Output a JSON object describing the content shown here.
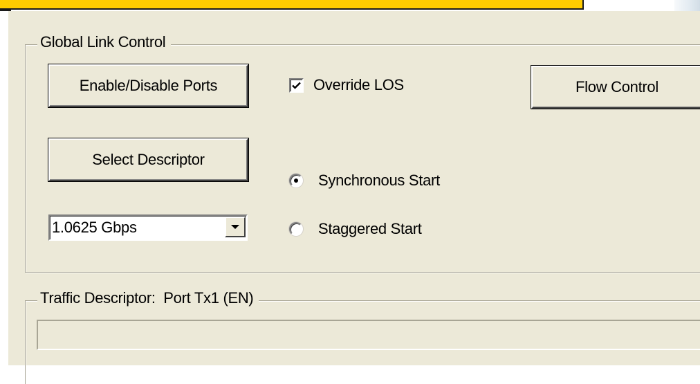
{
  "global_link_control": {
    "title": "Global Link Control",
    "enable_disable_ports_label": "Enable/Disable Ports",
    "override_los": {
      "label": "Override LOS",
      "checked": true
    },
    "flow_control_label": "Flow Control",
    "select_descriptor_label": "Select Descriptor",
    "start_mode": {
      "options": [
        {
          "label": "Synchronous Start",
          "selected": true
        },
        {
          "label": "Staggered Start",
          "selected": false
        }
      ]
    },
    "speed_select": {
      "value": "1.0625 Gbps"
    }
  },
  "traffic_descriptor": {
    "title_prefix": "Traffic Descriptor:",
    "title_port": "Port Tx1 (EN)",
    "field_value": ""
  },
  "icons": {
    "check": "checkmark-icon",
    "dropdown": "chevron-down-icon",
    "radio_dot": "radio-dot-icon"
  },
  "colors": {
    "title_bar": "#ffcc00",
    "panel_background": "#ece9d8",
    "groupbox_border": "#a8a595"
  }
}
